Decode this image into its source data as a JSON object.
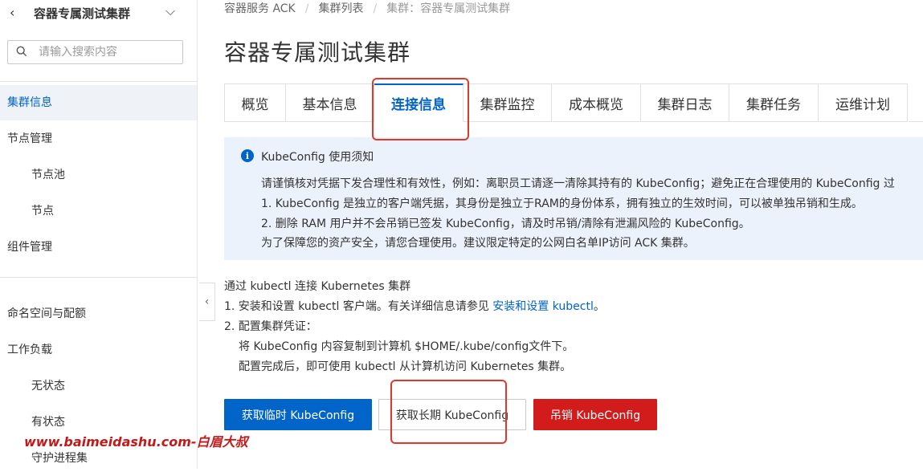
{
  "sidebar": {
    "back_label": "<",
    "title": "容器专属测试集群",
    "search_placeholder": "请输入搜索内容",
    "items": [
      {
        "label": "集群信息"
      },
      {
        "label": "节点管理"
      },
      {
        "label": "节点池"
      },
      {
        "label": "节点"
      },
      {
        "label": "组件管理"
      },
      {
        "label": "命名空间与配额"
      },
      {
        "label": "工作负载"
      },
      {
        "label": "无状态"
      },
      {
        "label": "有状态"
      },
      {
        "label": "守护进程集"
      }
    ]
  },
  "breadcrumb": {
    "items": [
      "容器服务 ACK",
      "集群列表",
      "集群：容器专属测试集群"
    ]
  },
  "page": {
    "title": "容器专属测试集群"
  },
  "tabs": [
    {
      "label": "概览"
    },
    {
      "label": "基本信息"
    },
    {
      "label": "连接信息"
    },
    {
      "label": "集群监控"
    },
    {
      "label": "成本概览"
    },
    {
      "label": "集群日志"
    },
    {
      "label": "集群任务"
    },
    {
      "label": "运维计划"
    }
  ],
  "notice": {
    "title": "KubeConfig 使用须知",
    "lines": [
      "请谨慎核对凭据下发合理性和有效性，例如：离职员工请逐一清除其持有的 KubeConfig；避免正在合理使用的 KubeConfig 过",
      "1. KubeConfig 是独立的客户端凭据，其身份是独立于RAM的身份体系，拥有独立的生效时间，可以被单独吊销和生成。",
      "2. 删除 RAM 用户并不会吊销已签发 KubeConfig，请及时吊销/清除有泄漏风险的 KubeConfig。",
      "为了保障您的资产安全，请您合理使用。建议限定特定的公网白名单IP访问 ACK 集群。"
    ]
  },
  "guide": {
    "heading": "通过 kubectl 连接 Kubernetes 集群",
    "step1_prefix": "1. 安装和设置 kubectl 客户端。有关详细信息请参见",
    "step1_link": "安装和设置 kubectl",
    "step1_suffix": "。",
    "step2": "2. 配置集群凭证：",
    "step2_a": "将 KubeConfig 内容复制到计算机 $HOME/.kube/config文件下。",
    "step2_b": "配置完成后，即可使用 kubectl 从计算机访问 Kubernetes 集群。"
  },
  "buttons": {
    "temp": "获取临时 KubeConfig",
    "long": "获取长期 KubeConfig",
    "revoke": "吊销 KubeConfig"
  },
  "watermark": "www.baimeidashu.com-白眉大叔",
  "colors": {
    "primary": "#0064c8",
    "danger": "#d21c1c",
    "highlight": "#e0392b",
    "notice_bg": "#ebf2fb"
  }
}
